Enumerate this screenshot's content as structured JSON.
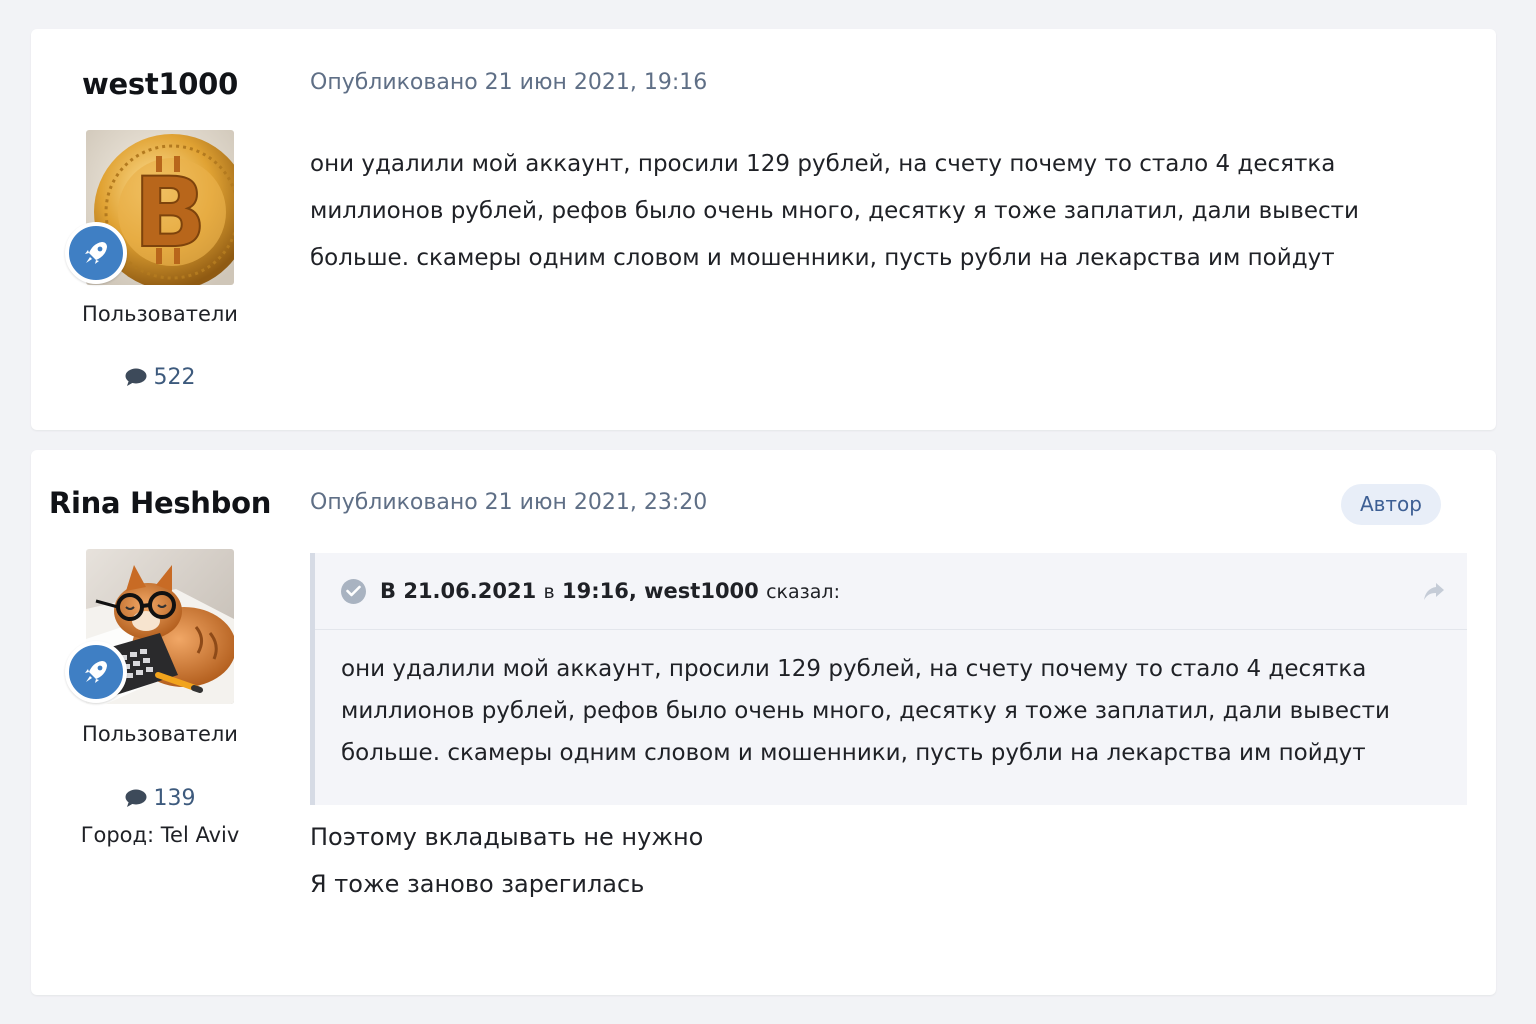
{
  "posts": [
    {
      "author": "west1000",
      "avatar": "bitcoin-avatar",
      "group": "Пользователи",
      "post_count": "522",
      "date": "Опубликовано 21 июн 2021, 19:16",
      "body_lines": [
        "они удалили мой аккаунт, просили 129 рублей, на счету почему то стало 4 десятка",
        "миллионов рублей, рефов было очень много, десятку я тоже заплатил, дали вывести",
        "больше. скамеры одним словом и мошенники, пусть рубли на лекарства им пойдут"
      ]
    },
    {
      "author": "Rina Heshbon",
      "avatar": "cat-with-glasses-avatar",
      "group": "Пользователи",
      "post_count": "139",
      "city": "Город: Tel Aviv",
      "date": "Опубликовано 21 июн 2021, 23:20",
      "badge": "Автор",
      "quote": {
        "cite_prefix": "В",
        "cite_date": "21.06.2021",
        "cite_in": "в",
        "cite_time": "19:16,",
        "cite_author": "west1000",
        "cite_said": "сказал:",
        "body_lines": [
          "они удалили мой аккаунт, просили 129 рублей, на счету почему то стало 4 десятка",
          "миллионов рублей, рефов было очень много, десятку я тоже заплатил, дали вывести",
          "больше. скамеры одним словом и мошенники, пусть рубли на лекарства им пойдут"
        ]
      },
      "body_lines": [
        "Поэтому вкладывать не нужно",
        "Я тоже заново зарегилась"
      ]
    }
  ],
  "colors": {
    "page_bg": "#f2f3f6",
    "accent": "#3f7fc4",
    "date_text": "#5f6f86",
    "badge_bg": "#e8eef8",
    "badge_text": "#3d5f94"
  },
  "icons": {
    "rank": "rocket-icon",
    "post_count": "speech-bubble-icon",
    "quote_check": "check-circle-icon",
    "quote_share": "share-arrow-icon"
  }
}
